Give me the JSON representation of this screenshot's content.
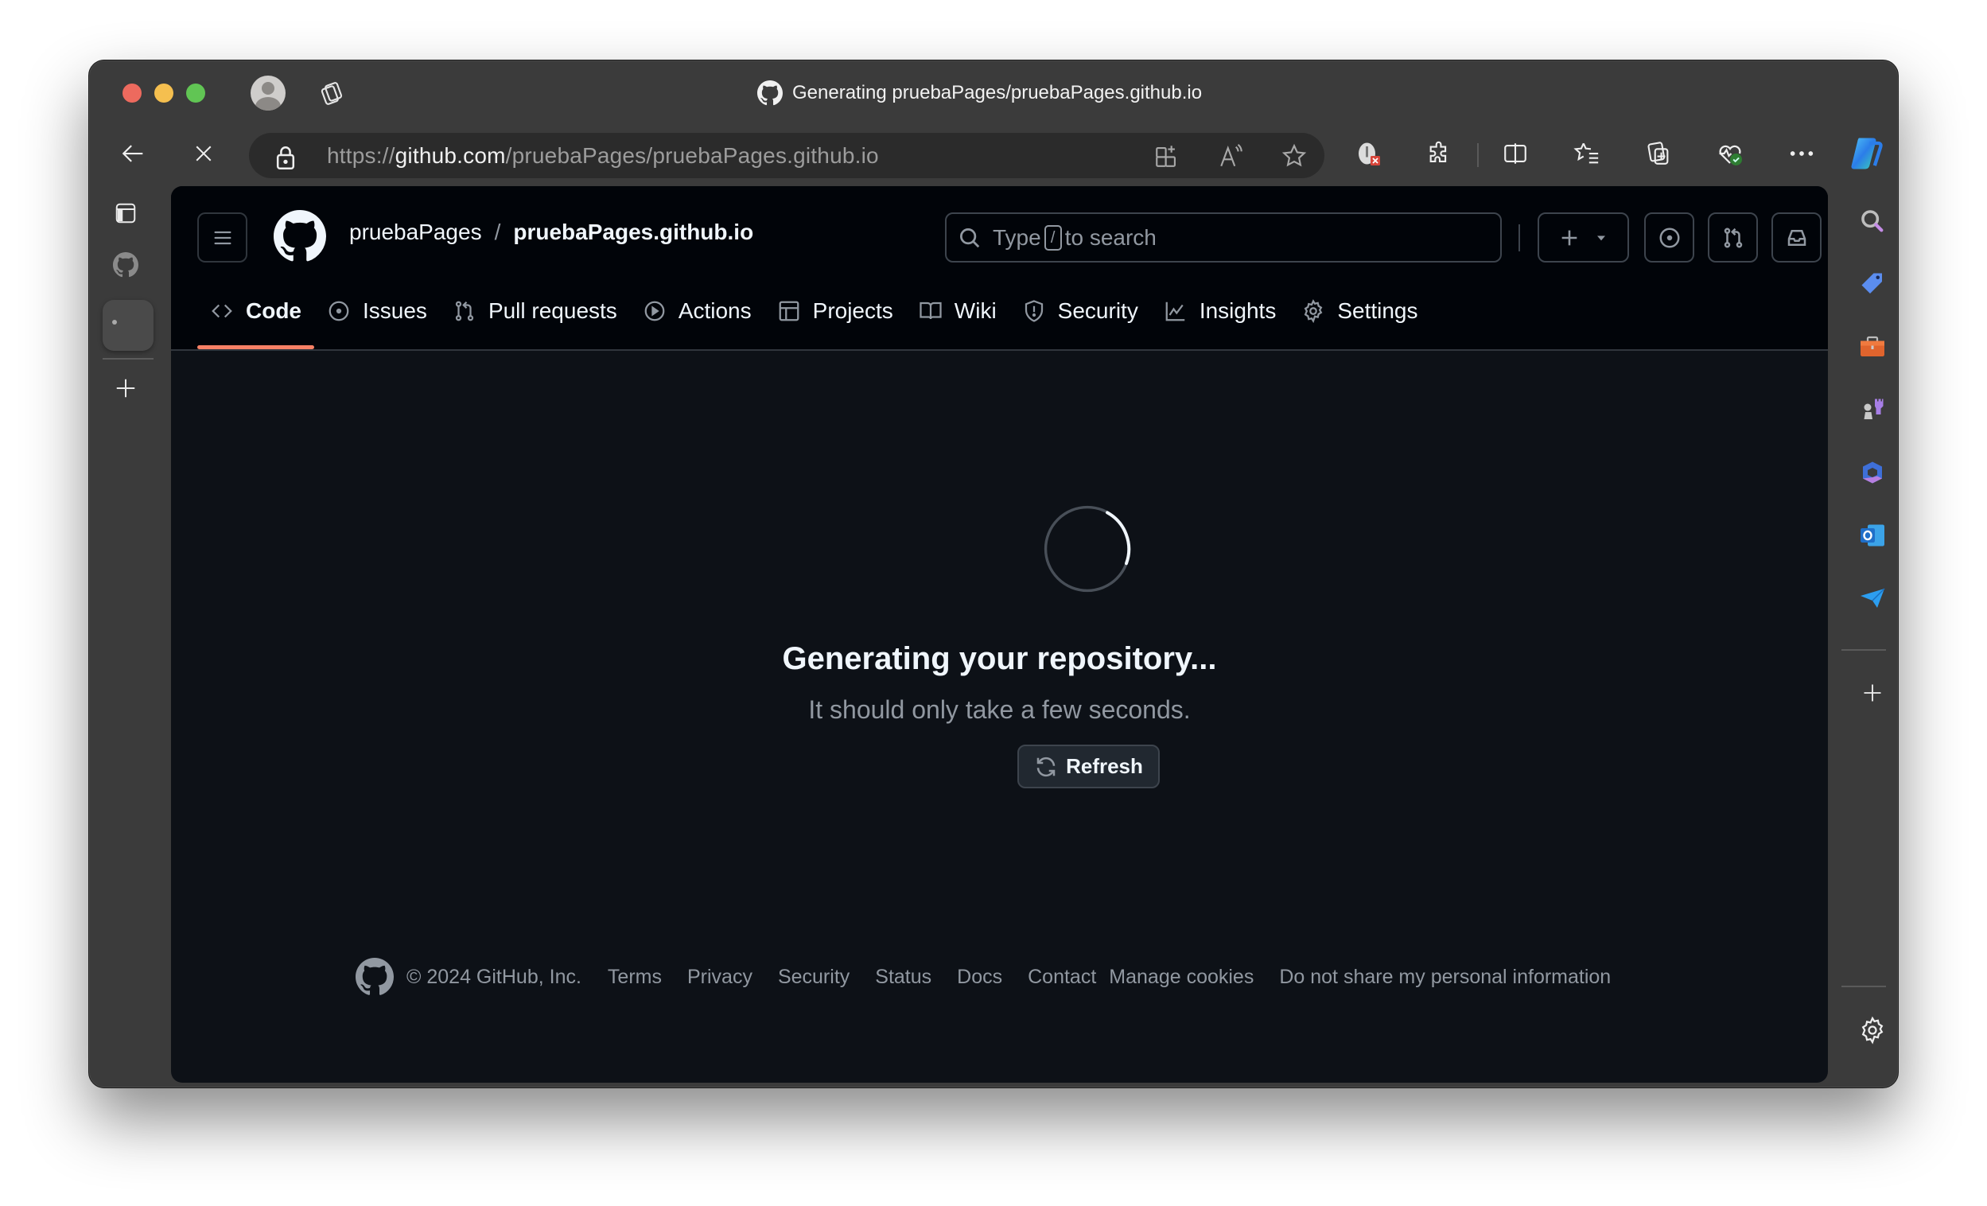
{
  "browser": {
    "window_title": "Generating pruebaPages/pruebaPages.github.io",
    "url_prefix": "https://",
    "url_domain": "github.com",
    "url_path": "/pruebaPages/pruebaPages.github.io",
    "toolbar_icons": [
      "add-to-collections-icon",
      "read-aloud-icon",
      "favorite-star-icon",
      "password-manager-icon",
      "extensions-icon",
      "split-screen-icon",
      "favorites-icon",
      "collections-icon",
      "browser-essentials-icon",
      "more-options-icon",
      "copilot-icon"
    ],
    "sidebar_icons": [
      "search-icon",
      "shopping-tag-icon",
      "tools-icon",
      "games-icon",
      "microsoft-365-icon",
      "outlook-icon",
      "drop-icon"
    ]
  },
  "github": {
    "owner": "pruebaPages",
    "separator": "/",
    "repo": "pruebaPages.github.io",
    "search": {
      "prefix": "Type",
      "key": "/",
      "suffix": "to search"
    },
    "tabs": [
      {
        "label": "Code",
        "icon": "code-icon",
        "active": true
      },
      {
        "label": "Issues",
        "icon": "issue-icon",
        "active": false
      },
      {
        "label": "Pull requests",
        "icon": "pull-request-icon",
        "active": false
      },
      {
        "label": "Actions",
        "icon": "actions-play-icon",
        "active": false
      },
      {
        "label": "Projects",
        "icon": "table-icon",
        "active": false
      },
      {
        "label": "Wiki",
        "icon": "book-icon",
        "active": false
      },
      {
        "label": "Security",
        "icon": "shield-icon",
        "active": false
      },
      {
        "label": "Insights",
        "icon": "graph-icon",
        "active": false
      },
      {
        "label": "Settings",
        "icon": "gear-icon",
        "active": false
      }
    ],
    "status": {
      "title": "Generating your repository...",
      "subtitle": "It should only take a few seconds.",
      "refresh_label": "Refresh"
    },
    "footer": {
      "copyright": "© 2024 GitHub, Inc.",
      "links": [
        "Terms",
        "Privacy",
        "Security",
        "Status",
        "Docs",
        "Contact",
        "Manage cookies",
        "Do not share my personal information"
      ]
    }
  },
  "colors": {
    "active_tab_underline": "#f78166",
    "avatar_accent": "#a8e6d4"
  }
}
